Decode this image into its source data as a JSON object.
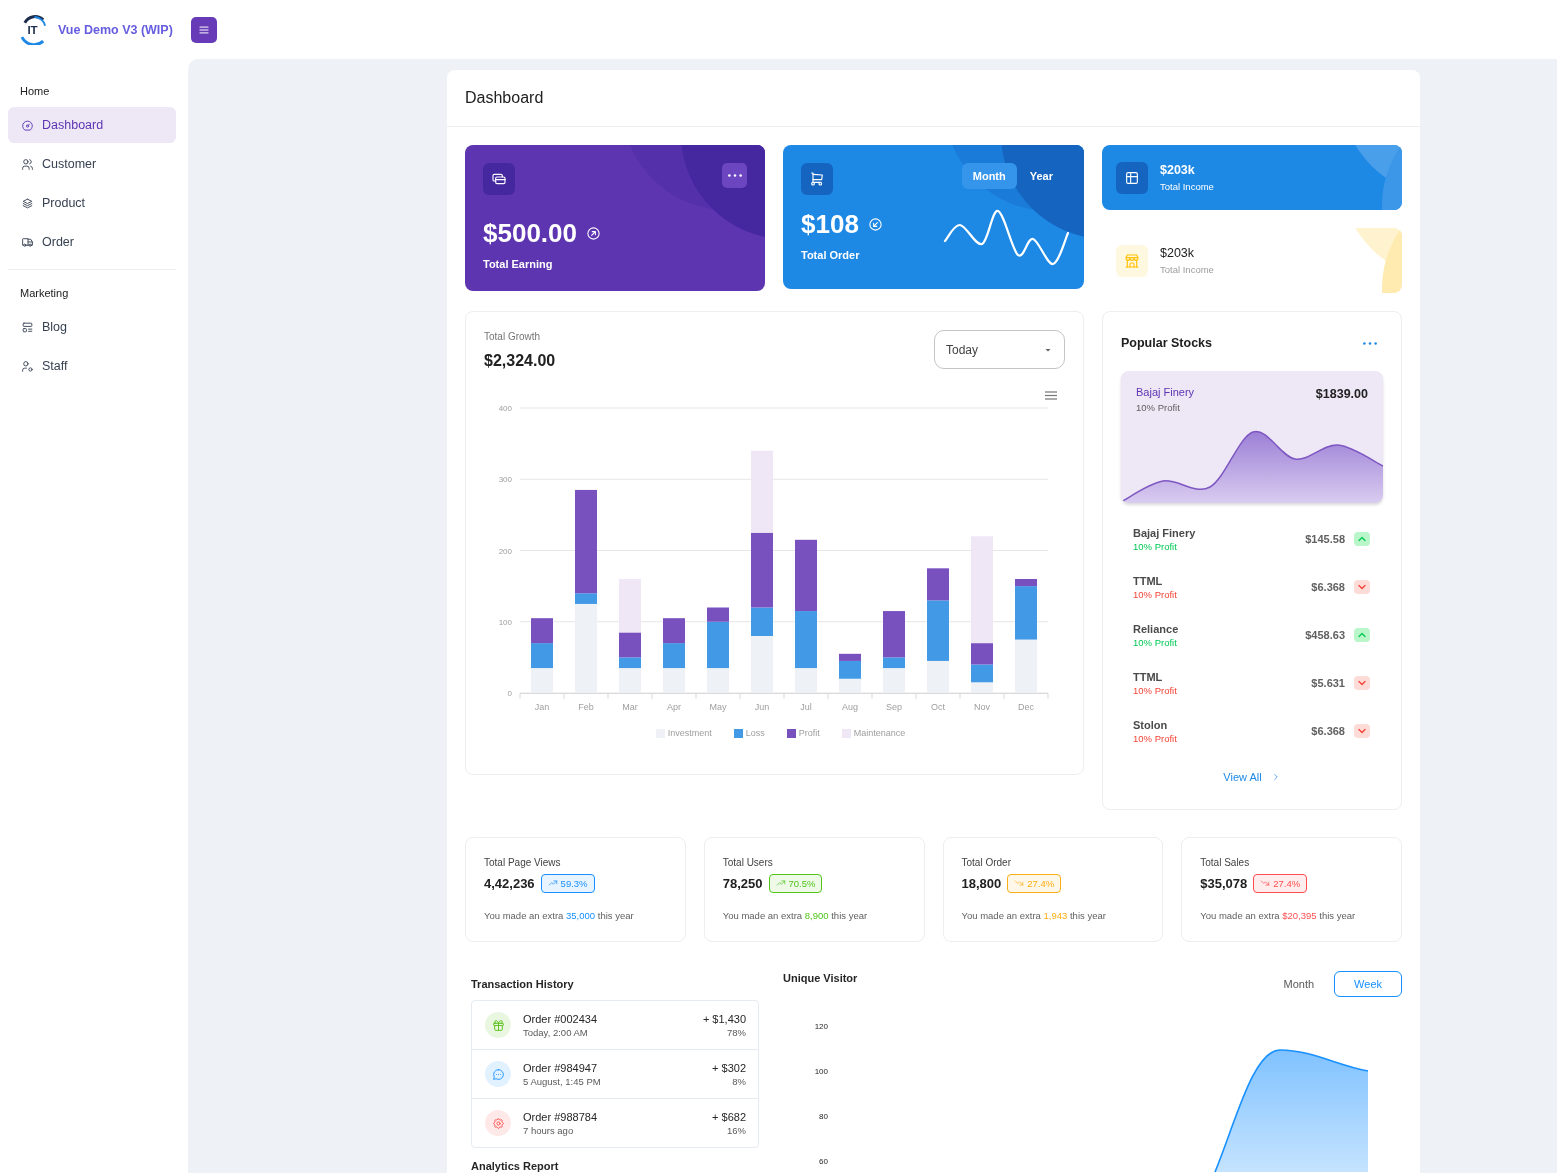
{
  "header": {
    "logo_mark": "IT",
    "brand": "Vue Demo V3 (WIP)"
  },
  "sidebar": {
    "groups": [
      {
        "title": "Home",
        "items": [
          {
            "label": "Dashboard",
            "selected": true
          },
          {
            "label": "Customer",
            "selected": false
          },
          {
            "label": "Product",
            "selected": false
          },
          {
            "label": "Order",
            "selected": false
          }
        ]
      },
      {
        "title": "Marketing",
        "items": [
          {
            "label": "Blog",
            "selected": false
          },
          {
            "label": "Staff",
            "selected": false
          }
        ]
      }
    ]
  },
  "page": {
    "title": "Dashboard"
  },
  "earning_card": {
    "amount": "$500.00",
    "label": "Total Earning"
  },
  "order_card": {
    "tabs": [
      {
        "label": "Month",
        "selected": true
      },
      {
        "label": "Year",
        "selected": false
      }
    ],
    "amount": "$108",
    "label": "Total Order"
  },
  "income_cards": [
    {
      "kind": "filled",
      "amount": "$203k",
      "label": "Total Income"
    },
    {
      "kind": "plain",
      "amount": "$203k",
      "label": "Total Income"
    }
  ],
  "growth": {
    "label": "Total Growth",
    "amount": "$2,324.00",
    "period": {
      "value": "Today"
    },
    "chart_data": [
      {
        "type": "bar",
        "stacked": true,
        "categories": [
          "Jan",
          "Feb",
          "Mar",
          "Apr",
          "May",
          "Jun",
          "Jul",
          "Aug",
          "Sep",
          "Oct",
          "Nov",
          "Dec"
        ],
        "ylim": [
          0,
          400
        ],
        "yticks": [
          0,
          100,
          200,
          300,
          400
        ],
        "grid": true,
        "legend": "bottom",
        "series": [
          {
            "name": "Investment",
            "color": "#eef2f6",
            "values": [
              35,
              125,
              35,
              35,
              35,
              80,
              35,
              20,
              35,
              45,
              15,
              75
            ]
          },
          {
            "name": "Loss",
            "color": "#4299e6",
            "values": [
              35,
              15,
              15,
              35,
              65,
              40,
              80,
              25,
              15,
              85,
              25,
              75
            ]
          },
          {
            "name": "Profit",
            "color": "#7851bf",
            "values": [
              35,
              145,
              35,
              35,
              20,
              105,
              100,
              10,
              65,
              45,
              30,
              10
            ]
          },
          {
            "name": "Maintenance",
            "color": "#efe7f6",
            "values": [
              0,
              0,
              75,
              0,
              0,
              115,
              0,
              0,
              0,
              0,
              150,
              0
            ]
          }
        ]
      }
    ]
  },
  "stocks": {
    "title": "Popular Stocks",
    "featured": {
      "name": "Bajaj Finery",
      "note": "10% Profit",
      "price": "$1839.00"
    },
    "items": [
      {
        "name": "Bajaj Finery",
        "note": "10% Profit",
        "price": "$145.58",
        "rising": true
      },
      {
        "name": "TTML",
        "note": "10% Profit",
        "price": "$6.368",
        "rising": false
      },
      {
        "name": "Reliance",
        "note": "10% Profit",
        "price": "$458.63",
        "rising": true
      },
      {
        "name": "TTML",
        "note": "10% Profit",
        "price": "$5.631",
        "rising": false
      },
      {
        "name": "Stolon",
        "note": "10% Profit",
        "price": "$6.368",
        "rising": false
      }
    ],
    "link": "View All"
  },
  "stats": [
    {
      "title": "Total Page Views",
      "value": "4,42,236",
      "change": "59.3%",
      "rising": true,
      "color": "#1890ff",
      "note": {
        "before": "You made an extra",
        "amount": "35,000",
        "after": "this year"
      }
    },
    {
      "title": "Total Users",
      "value": "78,250",
      "change": "70.5%",
      "rising": true,
      "color": "#52c41a",
      "note": {
        "before": "You made an extra",
        "amount": "8,900",
        "after": "this year"
      }
    },
    {
      "title": "Total Order",
      "value": "18,800",
      "change": "27.4%",
      "rising": false,
      "color": "#faad14",
      "note": {
        "before": "You made an extra",
        "amount": "1,943",
        "after": "this year"
      }
    },
    {
      "title": "Total Sales",
      "value": "$35,078",
      "change": "27.4%",
      "rising": false,
      "color": "#ff4d4f",
      "note": {
        "before": "You made an extra",
        "amount": "$20,395",
        "after": "this year"
      }
    }
  ],
  "transactions": {
    "title": "Transaction History",
    "items": [
      {
        "title": "Order #002434",
        "time": "Today, 2:00 AM",
        "amount": "+ $1,430",
        "share": "78%",
        "color": "#e9f7e1"
      },
      {
        "title": "Order #984947",
        "time": "5 August, 1:45 PM",
        "amount": "+ $302",
        "share": "8%",
        "color": "#e1f1ff"
      },
      {
        "title": "Order #988784",
        "time": "7 hours ago",
        "amount": "+ $682",
        "share": "16%",
        "color": "#ffe8e8"
      }
    ]
  },
  "analytics": {
    "title": "Analytics Report"
  },
  "visitors": {
    "title": "Unique Visitor",
    "tabs": [
      {
        "label": "Month",
        "selected": false
      },
      {
        "label": "Week",
        "selected": true
      }
    ],
    "y_axis_labels": [
      "120",
      "100",
      "80",
      "60"
    ]
  }
}
